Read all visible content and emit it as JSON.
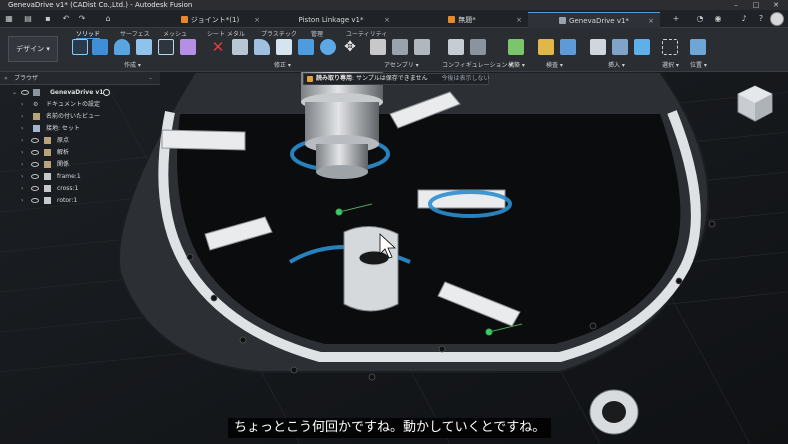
{
  "window": {
    "title": "GenevaDrive v1* (CADist Co.,Ltd.) - Autodesk Fusion"
  },
  "tabs": [
    {
      "label": "ジョイント*(1)",
      "active": false
    },
    {
      "label": "Piston Linkage v1*",
      "active": false
    },
    {
      "label": "無題*",
      "active": false
    },
    {
      "label": "GenevaDrive v1*",
      "active": true
    }
  ],
  "toolbar": {
    "workspace": "デザイン",
    "ribbon_tabs": [
      "ソリッド",
      "サーフェス",
      "メッシュ",
      "シート メタル",
      "プラスチック",
      "管理",
      "ユーティリティ"
    ],
    "groups": [
      "作成",
      "修正",
      "アセンブリ",
      "コンフィギュレーション",
      "構築",
      "検査",
      "挿入",
      "選択",
      "位置"
    ]
  },
  "browser": {
    "title": "ブラウザ",
    "root": "GenevaDrive v1",
    "items": [
      {
        "label": "ドキュメントの設定",
        "icon": "gear-icon",
        "eye": false
      },
      {
        "label": "名前の付いたビュー",
        "icon": "folder-icon",
        "eye": false
      },
      {
        "label": "接地: セット",
        "icon": "ground-icon",
        "eye": false
      },
      {
        "label": "原点",
        "icon": "folder-icon",
        "eye": true
      },
      {
        "label": "解析",
        "icon": "folder-icon",
        "eye": true
      },
      {
        "label": "関係",
        "icon": "folder-icon",
        "eye": true
      },
      {
        "label": "frame:1",
        "icon": "component-icon",
        "eye": true
      },
      {
        "label": "cross:1",
        "icon": "component-icon",
        "eye": true
      },
      {
        "label": "rotor:1",
        "icon": "component-icon",
        "eye": true
      }
    ]
  },
  "notice": {
    "label": "読み取り専用",
    "message": ":  サンプルは保存できません",
    "action": "今後は表示しない"
  },
  "subtitle": "ちょっとこう何回かですね。動かしていくとですね。",
  "colors": {
    "accent": "#4d9be0",
    "ribbon_bg": "#2a2e33",
    "viewport_bg": "#15181b"
  }
}
